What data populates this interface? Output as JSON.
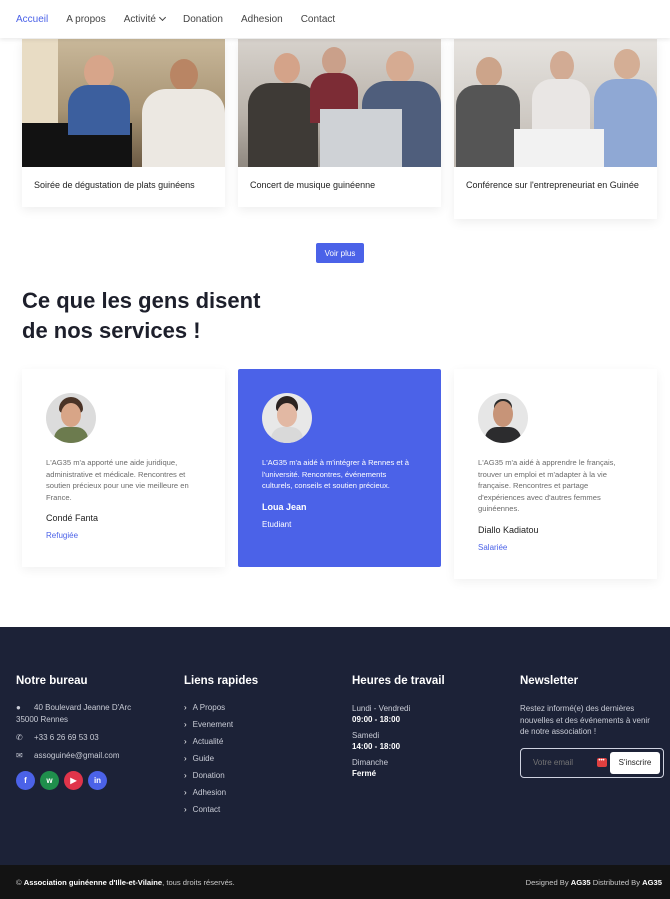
{
  "nav": {
    "items": [
      "Accueil",
      "A propos",
      "Activité",
      "Donation",
      "Adhesion",
      "Contact"
    ]
  },
  "events": {
    "cards": [
      {
        "title": "Soirée de dégustation de plats guinéens"
      },
      {
        "title": "Concert de musique guinéenne"
      },
      {
        "title": "Conférence sur l'entrepreneuriat en Guinée"
      }
    ],
    "more_label": "Voir plus"
  },
  "testimonials": {
    "heading_line1": "Ce que les gens disent",
    "heading_line2": "de nos services !",
    "items": [
      {
        "text": "L'AG35 m'a apporté une aide juridique, administrative et médicale. Rencontres et soutien précieux pour une vie meilleure en France.",
        "name": "Condé Fanta",
        "role": "Refugiée"
      },
      {
        "text": "L'AG35 m'a aidé à m'intégrer à Rennes et à l'université. Rencontres, événements culturels, conseils et soutien précieux.",
        "name": "Loua Jean",
        "role": "Etudiant"
      },
      {
        "text": "L'AG35 m'a aidé à apprendre le français, trouver un emploi et m'adapter à la vie française. Rencontres et partage d'expériences avec d'autres femmes guinéennes.",
        "name": "Diallo Kadiatou",
        "role": "Salariée"
      }
    ]
  },
  "footer": {
    "office": {
      "title": "Notre bureau",
      "address_line1": "40 Boulevard Jeanne D'Arc",
      "address_line2": "35000 Rennes",
      "phone": "+33 6 26 69 53 03",
      "email": "assoguinée@gmail.com",
      "social": [
        "f",
        "w",
        "▶",
        "in"
      ]
    },
    "links": {
      "title": "Liens rapides",
      "items": [
        "A Propos",
        "Evenement",
        "Actualité",
        "Guide",
        "Donation",
        "Adhesion",
        "Contact"
      ]
    },
    "hours": {
      "title": "Heures de travail",
      "rows": [
        {
          "label": "Lundi - Vendredi",
          "value": "09:00  - 18:00"
        },
        {
          "label": "Samedi",
          "value": "14:00 - 18:00"
        },
        {
          "label": "Dimanche",
          "value": "Fermé"
        }
      ]
    },
    "newsletter": {
      "title": "Newsletter",
      "text": "Restez informé(e) des dernières nouvelles et des événements à venir de notre association !",
      "placeholder": "Votre email",
      "button": "S'inscrire"
    }
  },
  "bottom": {
    "copyright_prefix": "©",
    "org": "Association guinéenne d'Ille-et-Vilaine",
    "copyright_suffix": ", tous droits réservés.",
    "designed_by": "Designed By",
    "designer": "AG35",
    "distributed_by": "Distributed By",
    "distributor": "AG35"
  },
  "colors": {
    "accent": "#4b62e8",
    "footer_bg": "#1c2237",
    "bottom_bg": "#131313"
  }
}
